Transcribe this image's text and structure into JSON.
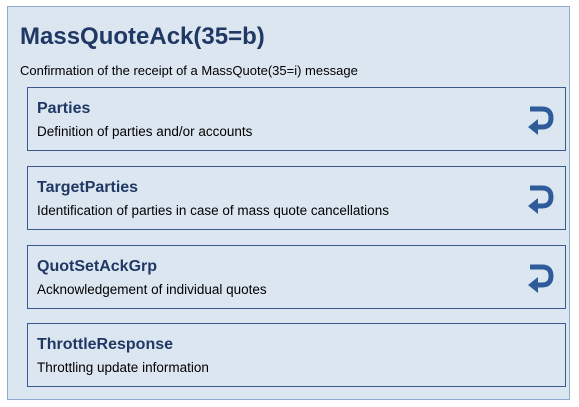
{
  "message": {
    "title": "MassQuoteAck(35=b)",
    "description": "Confirmation of the receipt of a MassQuote(35=i) message"
  },
  "components": [
    {
      "name": "Parties",
      "description": "Definition of parties and/or accounts",
      "repeating": true,
      "icon": "repeat-arrow-icon"
    },
    {
      "name": "TargetParties",
      "description": "Identification of parties in case of mass quote cancellations",
      "repeating": true,
      "icon": "repeat-arrow-icon"
    },
    {
      "name": "QuotSetAckGrp",
      "description": "Acknowledgement of individual quotes",
      "repeating": true,
      "icon": "repeat-arrow-icon"
    },
    {
      "name": "ThrottleResponse",
      "description": "Throttling update information",
      "repeating": false
    }
  ],
  "colors": {
    "panel_fill": "#dce6f1",
    "title_text": "#1f3864",
    "box_border": "#3a5a8c",
    "icon": "#2e5c9a"
  }
}
